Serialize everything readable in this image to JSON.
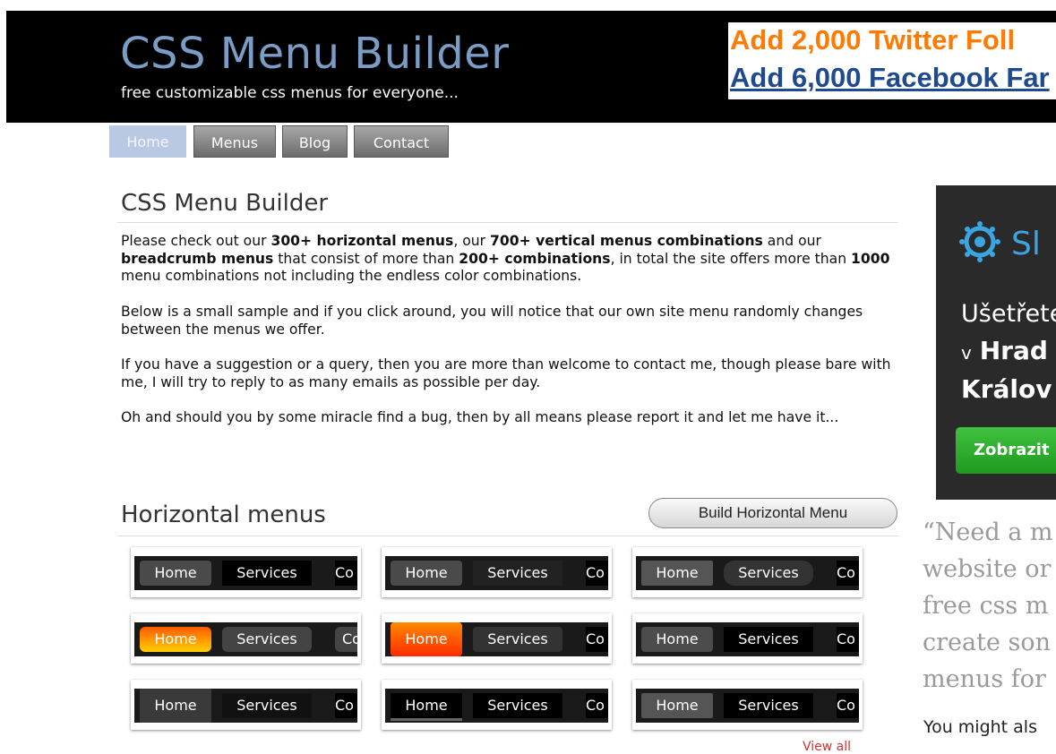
{
  "header": {
    "title": "CSS Menu Builder",
    "tagline": "free customizable css menus for everyone...",
    "ad_line1": "Add 2,000 Twitter Foll",
    "ad_line2": "Add 6,000 Facebook Far"
  },
  "nav": {
    "tabs": [
      {
        "label": "Home"
      },
      {
        "label": "Menus"
      },
      {
        "label": "Blog"
      },
      {
        "label": "Contact"
      }
    ],
    "active": "Home"
  },
  "main": {
    "title": "CSS Menu Builder",
    "p1": {
      "t1": "Please check out our ",
      "b1": "300+ horizontal menus",
      "t2": ", our ",
      "b2": "700+ vertical menus combinations",
      "t3": " and our ",
      "b3": "breadcrumb menus",
      "t4": " that consist of more than ",
      "b4": "200+ combinations",
      "t5": ", in total the site offers more than ",
      "b5": "1000",
      "t6": " menu combinations not including the endless color combinations."
    },
    "p2": "Below is a small sample and if you click around, you will notice that our own site menu randomly changes between the menus we offer.",
    "p3": "If you have a suggestion or a query, then you are more than welcome to contact me, though please bare with me, I will try to reply to as many emails as possible per day.",
    "p4": "Oh and should you by some miracle find a bug, then by all means please report it and let me have it..."
  },
  "horizontal": {
    "title": "Horizontal menus",
    "build_button": "Build Horizontal Menu",
    "view_all": "View all",
    "sample_items": [
      "Home",
      "Services",
      "Co"
    ]
  },
  "sidebar": {
    "ad": {
      "logo_text": "Sl",
      "line1": "Ušetřete",
      "line2_prefix": "v",
      "line2_bold": "Hrad",
      "line3": "Králov",
      "cta": "Zobrazit"
    },
    "quote_lines": [
      "“Need a m",
      "website or",
      "free css m",
      "create son",
      "menus for"
    ],
    "might_also": "You might als"
  },
  "colors": {
    "header_bg": "#000000",
    "logo_blue": "#7b9dc5",
    "ad_orange": "#ff7a00",
    "ad_blue": "#1f4a8e",
    "nav_active": "#b9c8e3",
    "side_ad_bg": "#2a2a2a",
    "cta_green": "#2aa92a"
  }
}
